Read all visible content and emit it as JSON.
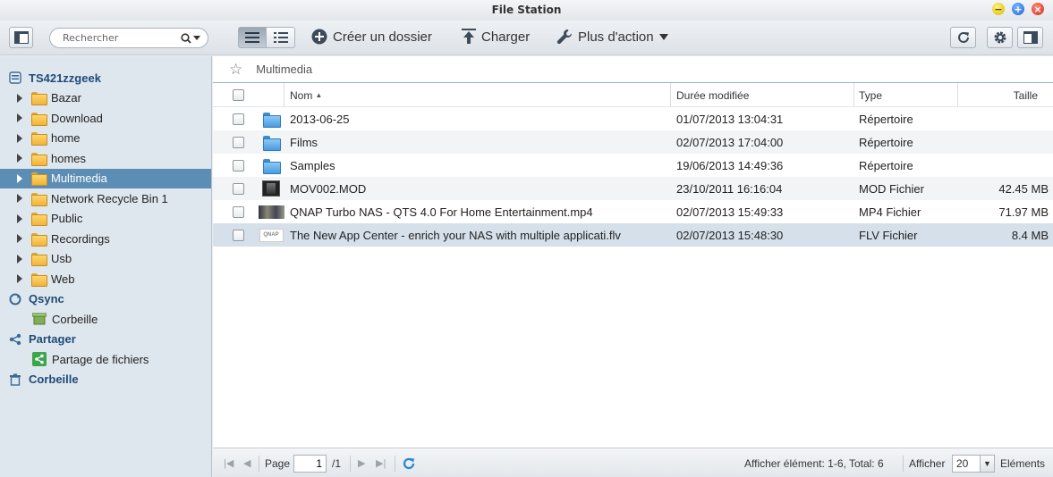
{
  "window": {
    "title": "File Station"
  },
  "toolbar": {
    "search_placeholder": "Rechercher",
    "create_folder": "Créer un dossier",
    "upload": "Charger",
    "more_actions": "Plus d'action"
  },
  "sidebar": {
    "nas": "TS421zzgeek",
    "folders": [
      "Bazar",
      "Download",
      "home",
      "homes",
      "Multimedia",
      "Network Recycle Bin 1",
      "Public",
      "Recordings",
      "Usb",
      "Web"
    ],
    "selected_folder": "Multimedia",
    "qsync": "Qsync",
    "qsync_trash": "Corbeille",
    "share": "Partager",
    "share_files": "Partage de fichiers",
    "trash": "Corbeille"
  },
  "path": {
    "current": "Multimedia"
  },
  "columns": {
    "name": "Nom",
    "modified": "Durée modifiée",
    "type": "Type",
    "size": "Taille"
  },
  "files": [
    {
      "name": "2013-06-25",
      "modified": "01/07/2013 13:04:31",
      "type": "Répertoire",
      "size": "",
      "icon": "folder-icon"
    },
    {
      "name": "Films",
      "modified": "02/07/2013 17:04:00",
      "type": "Répertoire",
      "size": "",
      "icon": "folder-icon"
    },
    {
      "name": "Samples",
      "modified": "19/06/2013 14:49:36",
      "type": "Répertoire",
      "size": "",
      "icon": "folder-icon"
    },
    {
      "name": "MOV002.MOD",
      "modified": "23/10/2011 16:16:04",
      "type": "MOD Fichier",
      "size": "42.45 MB",
      "icon": "video-thumbnail-icon"
    },
    {
      "name": "QNAP Turbo NAS - QTS 4.0 For Home Entertainment.mp4",
      "modified": "02/07/2013 15:49:33",
      "type": "MP4 Fichier",
      "size": "71.97 MB",
      "icon": "video-thumbnail-icon"
    },
    {
      "name": "The New App Center - enrich your NAS with multiple applicati.flv",
      "modified": "02/07/2013 15:48:30",
      "type": "FLV Fichier",
      "size": "8.4 MB",
      "icon": "video-thumbnail-icon"
    }
  ],
  "footer": {
    "page_label": "Page",
    "page_value": "1",
    "page_total": "/1",
    "display_info": "Afficher élément: 1-6, Total: 6",
    "show_label": "Afficher",
    "per_page": "20",
    "items_label": "Eléments"
  }
}
